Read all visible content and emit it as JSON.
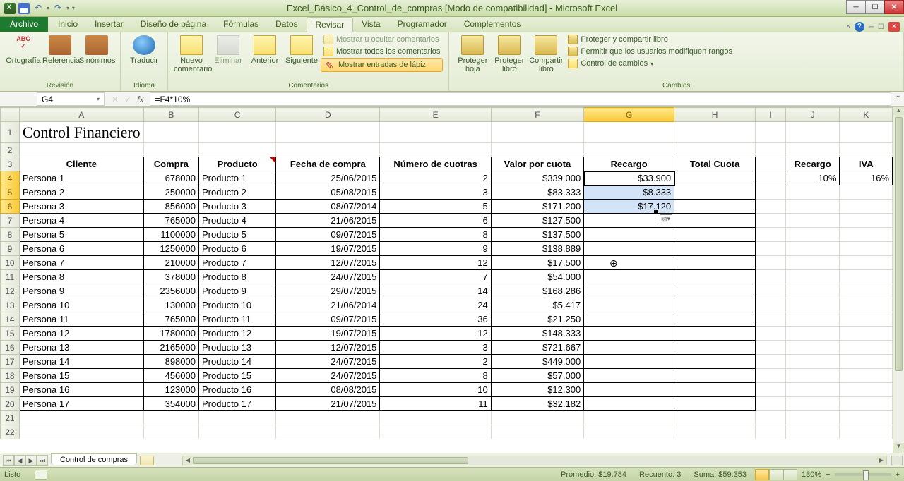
{
  "window": {
    "title": "Excel_Básico_4_Control_de_compras  [Modo de compatibilidad]  -  Microsoft Excel"
  },
  "ribbon": {
    "file": "Archivo",
    "tabs": [
      "Inicio",
      "Insertar",
      "Diseño de página",
      "Fórmulas",
      "Datos",
      "Revisar",
      "Vista",
      "Programador",
      "Complementos"
    ],
    "active_tab": "Revisar",
    "groups": {
      "revision": {
        "label": "Revisión",
        "ortografia": "Ortografía",
        "referencia": "Referencia",
        "sinonimos": "Sinónimos"
      },
      "idioma": {
        "label": "Idioma",
        "traducir": "Traducir"
      },
      "comentarios": {
        "label": "Comentarios",
        "nuevo": "Nuevo\ncomentario",
        "eliminar": "Eliminar",
        "anterior": "Anterior",
        "siguiente": "Siguiente",
        "mostrar_ocultar": "Mostrar u ocultar comentarios",
        "mostrar_todos": "Mostrar todos los comentarios",
        "mostrar_lapiz": "Mostrar entradas de lápiz"
      },
      "cambios": {
        "label": "Cambios",
        "proteger_hoja": "Proteger\nhoja",
        "proteger_libro": "Proteger\nlibro",
        "compartir_libro": "Compartir\nlibro",
        "proteger_compartir": "Proteger y compartir libro",
        "permitir": "Permitir que los usuarios modifiquen rangos",
        "control_cambios": "Control de cambios"
      }
    }
  },
  "namebox": {
    "value": "G4"
  },
  "formula": {
    "value": "=F4*10%"
  },
  "columns": [
    "A",
    "B",
    "C",
    "D",
    "E",
    "F",
    "G",
    "H",
    "I",
    "J",
    "K"
  ],
  "selected_col": "G",
  "selected_rows": [
    "4",
    "5",
    "6"
  ],
  "chart_data": {
    "type": "table",
    "title": "Control Financiero",
    "headers": [
      "Cliente",
      "Compra",
      "Producto",
      "Fecha de compra",
      "Número de cuotras",
      "Valor por cuota",
      "Recargo",
      "Total Cuota"
    ],
    "side_headers": [
      "Recargo",
      "IVA"
    ],
    "side_values": [
      "10%",
      "16%"
    ],
    "rows": [
      {
        "cliente": "Persona 1",
        "compra": "678000",
        "producto": "Producto 1",
        "fecha": "25/06/2015",
        "cuotas": "2",
        "valor": "$339.000",
        "recargo": "$33.900"
      },
      {
        "cliente": "Persona 2",
        "compra": "250000",
        "producto": "Producto 2",
        "fecha": "05/08/2015",
        "cuotas": "3",
        "valor": "$83.333",
        "recargo": "$8.333"
      },
      {
        "cliente": "Persona 3",
        "compra": "856000",
        "producto": "Producto 3",
        "fecha": "08/07/2014",
        "cuotas": "5",
        "valor": "$171.200",
        "recargo": "$17.120"
      },
      {
        "cliente": "Persona 4",
        "compra": "765000",
        "producto": "Producto 4",
        "fecha": "21/06/2015",
        "cuotas": "6",
        "valor": "$127.500",
        "recargo": ""
      },
      {
        "cliente": "Persona 5",
        "compra": "1100000",
        "producto": "Producto 5",
        "fecha": "09/07/2015",
        "cuotas": "8",
        "valor": "$137.500",
        "recargo": ""
      },
      {
        "cliente": "Persona 6",
        "compra": "1250000",
        "producto": "Producto 6",
        "fecha": "19/07/2015",
        "cuotas": "9",
        "valor": "$138.889",
        "recargo": ""
      },
      {
        "cliente": "Persona 7",
        "compra": "210000",
        "producto": "Producto 7",
        "fecha": "12/07/2015",
        "cuotas": "12",
        "valor": "$17.500",
        "recargo": ""
      },
      {
        "cliente": "Persona 8",
        "compra": "378000",
        "producto": "Producto 8",
        "fecha": "24/07/2015",
        "cuotas": "7",
        "valor": "$54.000",
        "recargo": ""
      },
      {
        "cliente": "Persona 9",
        "compra": "2356000",
        "producto": "Producto 9",
        "fecha": "29/07/2015",
        "cuotas": "14",
        "valor": "$168.286",
        "recargo": ""
      },
      {
        "cliente": "Persona 10",
        "compra": "130000",
        "producto": "Producto 10",
        "fecha": "21/06/2014",
        "cuotas": "24",
        "valor": "$5.417",
        "recargo": ""
      },
      {
        "cliente": "Persona 11",
        "compra": "765000",
        "producto": "Producto 11",
        "fecha": "09/07/2015",
        "cuotas": "36",
        "valor": "$21.250",
        "recargo": ""
      },
      {
        "cliente": "Persona 12",
        "compra": "1780000",
        "producto": "Producto 12",
        "fecha": "19/07/2015",
        "cuotas": "12",
        "valor": "$148.333",
        "recargo": ""
      },
      {
        "cliente": "Persona 13",
        "compra": "2165000",
        "producto": "Producto 13",
        "fecha": "12/07/2015",
        "cuotas": "3",
        "valor": "$721.667",
        "recargo": ""
      },
      {
        "cliente": "Persona 14",
        "compra": "898000",
        "producto": "Producto 14",
        "fecha": "24/07/2015",
        "cuotas": "2",
        "valor": "$449.000",
        "recargo": ""
      },
      {
        "cliente": "Persona 15",
        "compra": "456000",
        "producto": "Producto 15",
        "fecha": "24/07/2015",
        "cuotas": "8",
        "valor": "$57.000",
        "recargo": ""
      },
      {
        "cliente": "Persona 16",
        "compra": "123000",
        "producto": "Producto 16",
        "fecha": "08/08/2015",
        "cuotas": "10",
        "valor": "$12.300",
        "recargo": ""
      },
      {
        "cliente": "Persona 17",
        "compra": "354000",
        "producto": "Producto 17",
        "fecha": "21/07/2015",
        "cuotas": "11",
        "valor": "$32.182",
        "recargo": ""
      }
    ]
  },
  "sheet_tab": "Control de compras",
  "status": {
    "mode": "Listo",
    "promedio_label": "Promedio:",
    "promedio": "$19.784",
    "recuento_label": "Recuento:",
    "recuento": "3",
    "suma_label": "Suma:",
    "suma": "$59.353",
    "zoom": "130%"
  }
}
